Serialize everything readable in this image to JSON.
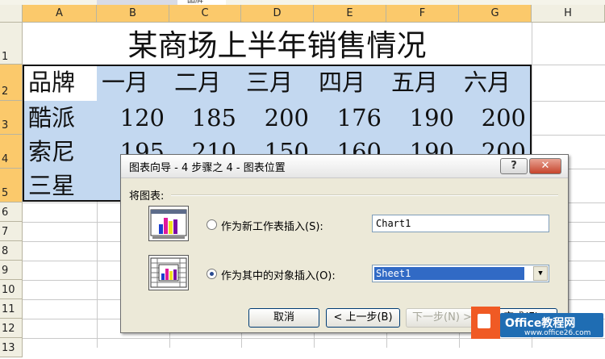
{
  "toolbar_fragment": "品牌",
  "spreadsheet": {
    "columns": [
      "A",
      "B",
      "C",
      "D",
      "E",
      "F",
      "G",
      "H"
    ],
    "rows": [
      "1",
      "2",
      "3",
      "4",
      "5",
      "6",
      "7",
      "8",
      "9",
      "10",
      "11",
      "12",
      "13"
    ],
    "title": "某商场上半年销售情况",
    "header": [
      "品牌",
      "一月",
      "二月",
      "三月",
      "四月",
      "五月",
      "六月"
    ],
    "data": [
      [
        "酷派",
        "120",
        "185",
        "200",
        "176",
        "190",
        "200"
      ],
      [
        "索尼",
        "195",
        "210",
        "150",
        "160",
        "190",
        "200"
      ],
      [
        "三星",
        "",
        "",
        "",
        "",
        "",
        ""
      ]
    ]
  },
  "dialog": {
    "title": "图表向导 - 4 步骤之 4 - 图表位置",
    "help_glyph": "?",
    "close_glyph": "✕",
    "group_label": "将图表:",
    "option_new_sheet": "作为新工作表插入(S):",
    "new_sheet_value": "Chart1",
    "option_object": "作为其中的对象插入(O):",
    "object_value": "Sheet1",
    "selected_option": "object",
    "buttons": {
      "cancel": "取消",
      "back": "< 上一步(B)",
      "next": "下一步(N) >",
      "finish": "完成(F)"
    }
  },
  "watermark": {
    "title": "Office教程网",
    "url": "www.office26.com"
  },
  "colors": {
    "selection_fill": "#c3d8f0",
    "header_highlight": "#fbc96b",
    "dialog_bg": "#ece9d8",
    "close_button": "#c6442c",
    "brand_orange": "#f05a24",
    "brand_blue": "#1f6db3"
  }
}
